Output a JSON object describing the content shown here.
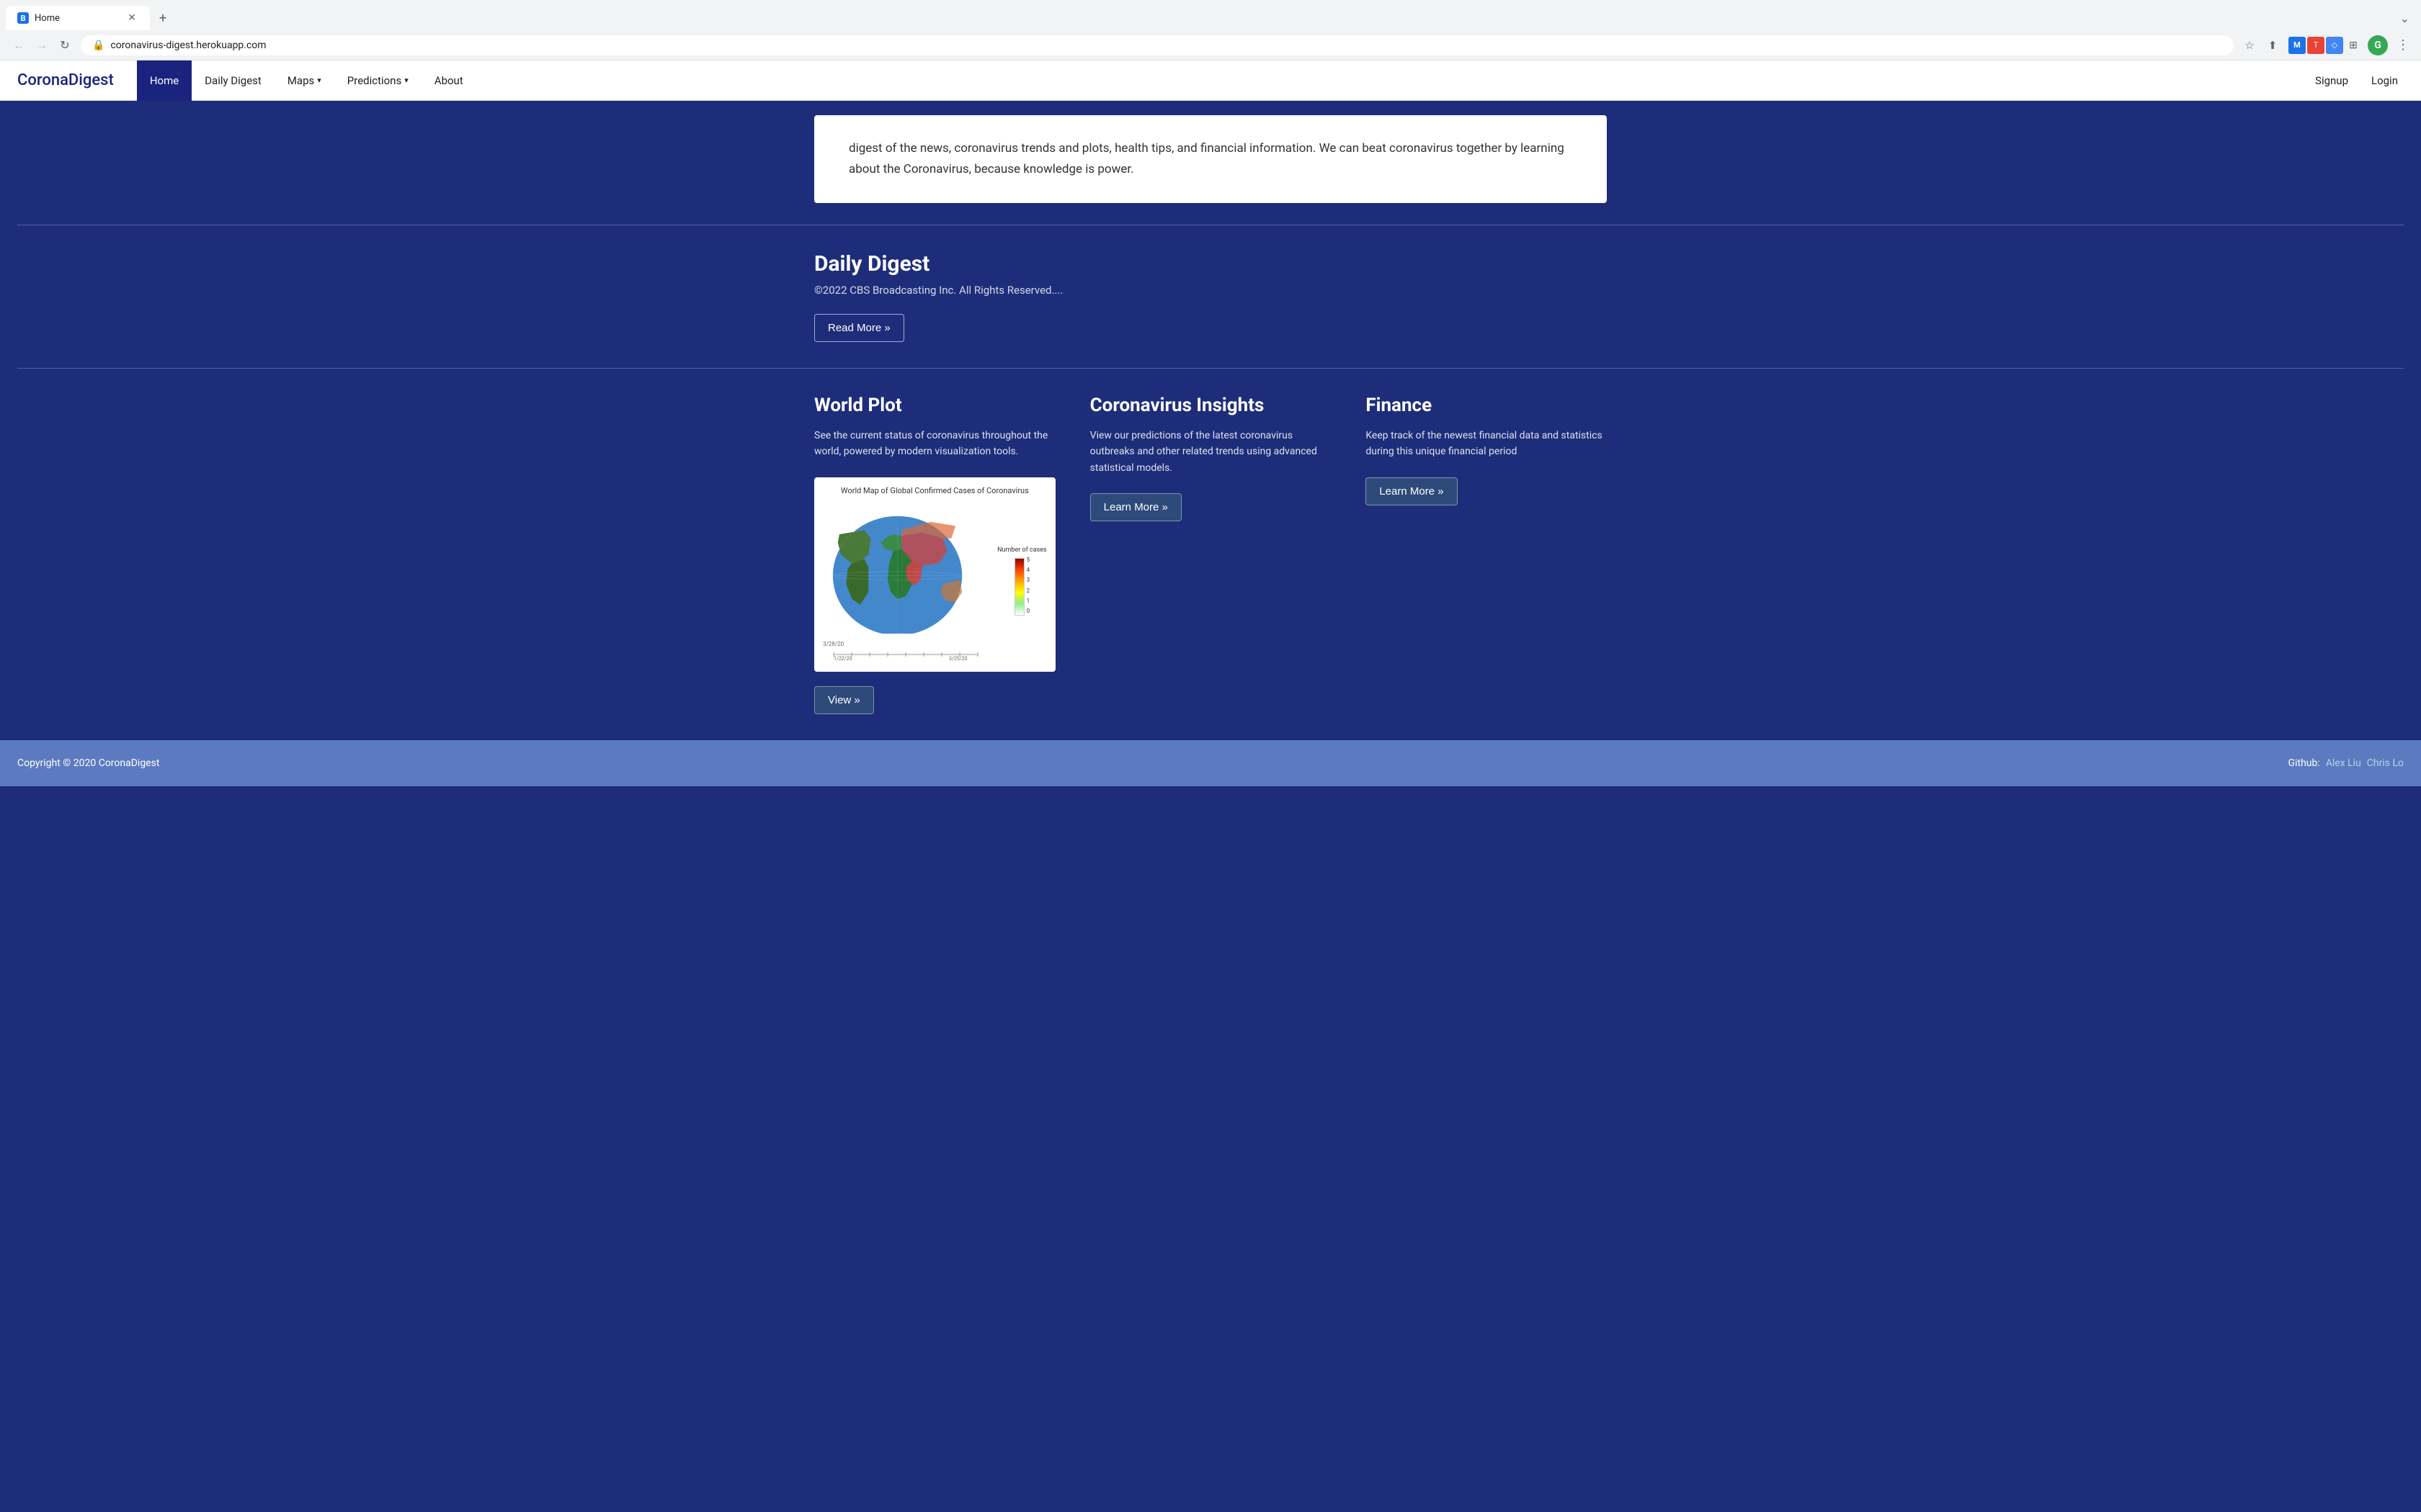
{
  "browser": {
    "tab_favicon": "B",
    "tab_title": "Home",
    "url": "coronavirus-digest.herokuapp.com",
    "lock_icon": "🔒"
  },
  "navbar": {
    "brand": "CoronaDigest",
    "links": [
      {
        "label": "Home",
        "active": true,
        "has_dropdown": false
      },
      {
        "label": "Daily Digest",
        "active": false,
        "has_dropdown": false
      },
      {
        "label": "Maps",
        "active": false,
        "has_dropdown": true
      },
      {
        "label": "Predictions",
        "active": false,
        "has_dropdown": true
      },
      {
        "label": "About",
        "active": false,
        "has_dropdown": false
      }
    ],
    "right_links": [
      {
        "label": "Signup"
      },
      {
        "label": "Login"
      }
    ]
  },
  "hero": {
    "text": "digest of the news, coronavirus trends and plots, health tips, and financial information. We can beat coronavirus together by learning about the Coronavirus, because knowledge is power."
  },
  "daily_digest": {
    "title": "Daily Digest",
    "subtitle": "©2022 CBS Broadcasting Inc. All Rights Reserved....",
    "button": "Read More »"
  },
  "world_plot": {
    "title": "World Plot",
    "description": "See the current status of coronavirus throughout the world, powered by modern visualization tools.",
    "button": "View »",
    "map_title": "World Map of Global Confirmed Cases of Coronavirus",
    "legend_title": "Number of cases",
    "legend_values": [
      "5",
      "4",
      "3",
      "2",
      "1",
      "0"
    ],
    "date_label": "3/28/20",
    "timeline_start": "1/22/20",
    "timeline_end": "3/25/20"
  },
  "insights": {
    "title": "Coronavirus Insights",
    "description": "View our predictions of the latest coronavirus outbreaks and other related trends using advanced statistical models.",
    "button": "Learn More »"
  },
  "finance": {
    "title": "Finance",
    "description": "Keep track of the newest financial data and statistics during this unique financial period",
    "button": "Learn More »"
  },
  "footer": {
    "copyright": "Copyright © 2020 CoronaDigest",
    "github_label": "Github:",
    "authors": [
      {
        "name": "Alex Liu",
        "link": true
      },
      {
        "name": "Chris Lo",
        "link": true
      }
    ]
  }
}
